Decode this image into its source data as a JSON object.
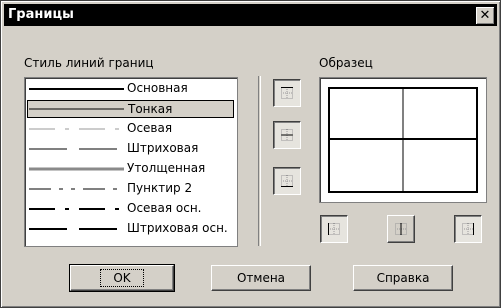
{
  "window": {
    "title": "Границы",
    "close_glyph": "✕"
  },
  "line_style": {
    "label": "Стиль линий границ",
    "items": [
      {
        "label": "Основная",
        "selected": false
      },
      {
        "label": "Тонкая",
        "selected": true
      },
      {
        "label": "Осевая",
        "selected": false
      },
      {
        "label": "Штриховая",
        "selected": false
      },
      {
        "label": "Утолщенная",
        "selected": false
      },
      {
        "label": "Пунктир 2",
        "selected": false
      },
      {
        "label": "Осевая осн.",
        "selected": false
      },
      {
        "label": "Штриховая осн.",
        "selected": false
      }
    ]
  },
  "sample": {
    "label": "Образец"
  },
  "buttons": {
    "ok": "OK",
    "cancel": "Отмена",
    "help": "Справка"
  },
  "icons": {
    "border_top": "border-top-icon",
    "border_inner_horizontal": "border-inner-horizontal-icon",
    "border_bottom": "border-bottom-icon",
    "border_left": "border-left-icon",
    "border_inner_vertical": "border-inner-vertical-icon",
    "border_right": "border-right-icon"
  }
}
